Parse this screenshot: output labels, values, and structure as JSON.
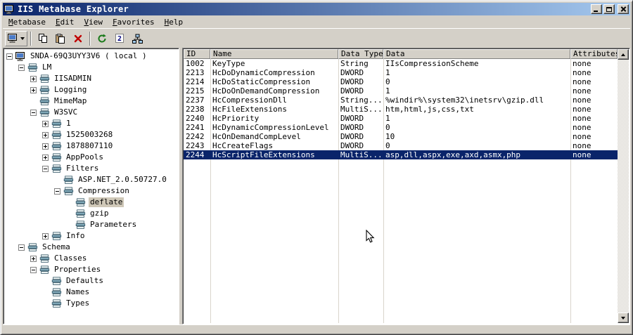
{
  "window": {
    "title": "IIS Metabase Explorer"
  },
  "menu": {
    "items": [
      "Metabase",
      "Edit",
      "View",
      "Favorites",
      "Help"
    ]
  },
  "toolbar": {
    "buttons": [
      {
        "name": "connect-button",
        "icon": "computer-icon",
        "dropdown": true
      },
      {
        "name": "separator"
      },
      {
        "name": "copy-button",
        "icon": "copy-icon"
      },
      {
        "name": "paste-button",
        "icon": "paste-icon"
      },
      {
        "name": "delete-button",
        "icon": "delete-icon"
      },
      {
        "name": "separator"
      },
      {
        "name": "refresh-button",
        "icon": "refresh-icon"
      },
      {
        "name": "id-display-button",
        "icon": "id-icon"
      },
      {
        "name": "network-button",
        "icon": "network-icon"
      }
    ]
  },
  "tree": {
    "items": [
      {
        "label": "SNDA-69Q3UYY3V6 ( local )",
        "depth": 0,
        "toggle": "minus",
        "icon": "computer",
        "selected": false
      },
      {
        "label": "LM",
        "depth": 1,
        "toggle": "minus",
        "icon": "node",
        "selected": false
      },
      {
        "label": "IISADMIN",
        "depth": 2,
        "toggle": "plus",
        "icon": "node",
        "selected": false
      },
      {
        "label": "Logging",
        "depth": 2,
        "toggle": "plus",
        "icon": "node",
        "selected": false
      },
      {
        "label": "MimeMap",
        "depth": 2,
        "toggle": "none",
        "icon": "node",
        "selected": false
      },
      {
        "label": "W3SVC",
        "depth": 2,
        "toggle": "minus",
        "icon": "node",
        "selected": false
      },
      {
        "label": "1",
        "depth": 3,
        "toggle": "plus",
        "icon": "node",
        "selected": false
      },
      {
        "label": "1525003268",
        "depth": 3,
        "toggle": "plus",
        "icon": "node",
        "selected": false
      },
      {
        "label": "1878807110",
        "depth": 3,
        "toggle": "plus",
        "icon": "node",
        "selected": false
      },
      {
        "label": "AppPools",
        "depth": 3,
        "toggle": "plus",
        "icon": "node",
        "selected": false
      },
      {
        "label": "Filters",
        "depth": 3,
        "toggle": "minus",
        "icon": "node",
        "selected": false
      },
      {
        "label": "ASP.NET_2.0.50727.0",
        "depth": 4,
        "toggle": "none",
        "icon": "node",
        "selected": false
      },
      {
        "label": "Compression",
        "depth": 4,
        "toggle": "minus",
        "icon": "node",
        "selected": false
      },
      {
        "label": "deflate",
        "depth": 5,
        "toggle": "none",
        "icon": "node",
        "selected": true
      },
      {
        "label": "gzip",
        "depth": 5,
        "toggle": "none",
        "icon": "node",
        "selected": false
      },
      {
        "label": "Parameters",
        "depth": 5,
        "toggle": "none",
        "icon": "node",
        "selected": false
      },
      {
        "label": "Info",
        "depth": 3,
        "toggle": "plus",
        "icon": "node",
        "selected": false
      },
      {
        "label": "Schema",
        "depth": 1,
        "toggle": "minus",
        "icon": "node",
        "selected": false
      },
      {
        "label": "Classes",
        "depth": 2,
        "toggle": "plus",
        "icon": "node",
        "selected": false
      },
      {
        "label": "Properties",
        "depth": 2,
        "toggle": "minus",
        "icon": "node",
        "selected": false
      },
      {
        "label": "Defaults",
        "depth": 3,
        "toggle": "none",
        "icon": "node",
        "selected": false
      },
      {
        "label": "Names",
        "depth": 3,
        "toggle": "none",
        "icon": "node",
        "selected": false
      },
      {
        "label": "Types",
        "depth": 3,
        "toggle": "none",
        "icon": "node",
        "selected": false
      }
    ]
  },
  "table": {
    "columns": [
      "ID",
      "Name",
      "Data Type",
      "Data",
      "Attributes"
    ],
    "rows": [
      {
        "cells": [
          "1002",
          "KeyType",
          "String",
          "IIsCompressionScheme",
          "none"
        ],
        "selected": false
      },
      {
        "cells": [
          "2213",
          "HcDoDynamicCompression",
          "DWORD",
          "1",
          "none"
        ],
        "selected": false
      },
      {
        "cells": [
          "2214",
          "HcDoStaticCompression",
          "DWORD",
          "0",
          "none"
        ],
        "selected": false
      },
      {
        "cells": [
          "2215",
          "HcDoOnDemandCompression",
          "DWORD",
          "1",
          "none"
        ],
        "selected": false
      },
      {
        "cells": [
          "2237",
          "HcCompressionDll",
          "String...",
          "%windir%\\system32\\inetsrv\\gzip.dll",
          "none"
        ],
        "selected": false
      },
      {
        "cells": [
          "2238",
          "HcFileExtensions",
          "MultiS...",
          "htm,html,js,css,txt",
          "none"
        ],
        "selected": false
      },
      {
        "cells": [
          "2240",
          "HcPriority",
          "DWORD",
          "1",
          "none"
        ],
        "selected": false
      },
      {
        "cells": [
          "2241",
          "HcDynamicCompressionLevel",
          "DWORD",
          "0",
          "none"
        ],
        "selected": false
      },
      {
        "cells": [
          "2242",
          "HcOnDemandCompLevel",
          "DWORD",
          "10",
          "none"
        ],
        "selected": false
      },
      {
        "cells": [
          "2243",
          "HcCreateFlags",
          "DWORD",
          "0",
          "none"
        ],
        "selected": false
      },
      {
        "cells": [
          "2244",
          "HcScriptFileExtensions",
          "MultiS...",
          "asp,dll,aspx,exe,axd,asmx,php",
          "none"
        ],
        "selected": true
      }
    ]
  },
  "colors": {
    "selection": "#0a246a",
    "titlebar_start": "#0a246a",
    "titlebar_end": "#a6caf0",
    "chrome": "#d4d0c8"
  }
}
